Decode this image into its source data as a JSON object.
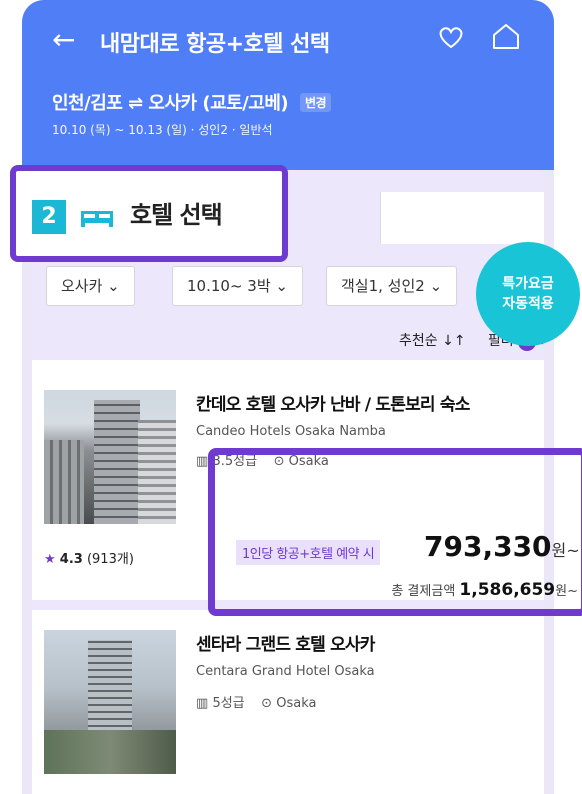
{
  "header": {
    "title": "내맘대로 항공+호텔 선택",
    "route": "인천/김포 ⇌ 오사카 (교토/고베)",
    "change_label": "변경",
    "dates": "10.10 (목) ~ 10.13 (일) · 성인2 · 일반석"
  },
  "step": {
    "number": "2",
    "label": "호텔 선택"
  },
  "filters": [
    {
      "label": "오사카 ⌄"
    },
    {
      "label": "10.10~ 3박 ⌄"
    },
    {
      "label": "객실1, 성인2 ⌄"
    }
  ],
  "sort": {
    "label": "추천순 ↓↑",
    "filter_label": "필터",
    "filter_count": "0"
  },
  "hotels": [
    {
      "name": "칸데오 호텔 오사카 난바 / 도톤보리 숙소",
      "name_en": "Candeo Hotels Osaka Namba",
      "grade": "3.5성급",
      "location": "Osaka",
      "rating": "4.3",
      "reviews": "(913개)"
    },
    {
      "name": "센타라 그랜드 호텔 오사카",
      "name_en": "Centara Grand Hotel Osaka",
      "grade": "5성급",
      "location": "Osaka"
    }
  ],
  "promo": {
    "line1": "특가요금",
    "line2": "자동적용"
  },
  "price": {
    "per_label": "1인당 항공+호텔 예약 시",
    "per_value": "793,330",
    "unit": "원~",
    "total_label": "총 결제금액",
    "total_value": "1,586,659",
    "total_unit": "원~"
  },
  "colors": {
    "header": "#4f7ef7",
    "accent": "#6e3ad0",
    "promo": "#19c4d7"
  }
}
